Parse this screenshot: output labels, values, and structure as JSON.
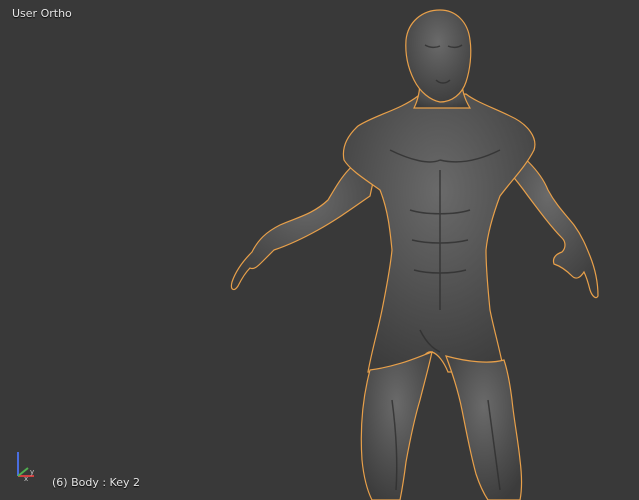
{
  "viewport": {
    "view_label": "User Ortho",
    "object_label": "(6) Body : Key 2",
    "background_color": "#393939",
    "selection_outline_color": "#e8a04a"
  },
  "model": {
    "icon": "human-body-mesh",
    "selected": true
  },
  "axis_gizmo": {
    "icon": "axis-gizmo-icon",
    "x_color": "#d04040",
    "y_color": "#50b050",
    "z_color": "#4a6ee0"
  }
}
